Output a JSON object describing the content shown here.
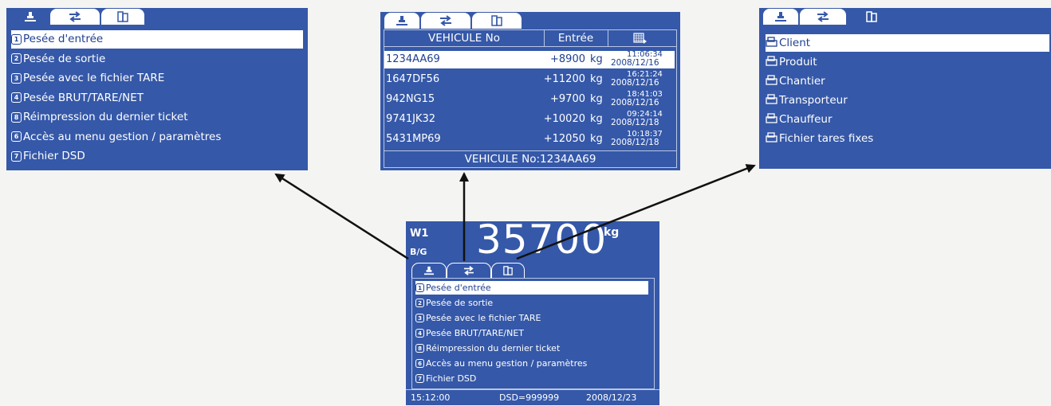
{
  "tabs": {
    "weigh_icon": "scale-icon",
    "transfer_icon": "transfer-arrows-icon",
    "files_icon": "files-icon"
  },
  "weigh_menu": {
    "items": [
      {
        "key": "F1",
        "label": "Pesée d'entrée"
      },
      {
        "key": "F2",
        "label": "Pesée de sortie"
      },
      {
        "key": "F3",
        "label": "Pesée avec le fichier TARE"
      },
      {
        "key": "F4",
        "label": "Pesée BRUT/TARE/NET"
      },
      {
        "key": "F8",
        "label": "Réimpression du dernier ticket"
      },
      {
        "key": "F6",
        "label": "Accès au menu gestion / paramètres"
      },
      {
        "key": "F7",
        "label": "Fichier DSD"
      }
    ]
  },
  "vehicle_table": {
    "headers": {
      "vehicle": "VEHICULE No",
      "entry": "Entrée",
      "datetime": "calendar-icon"
    },
    "rows": [
      {
        "plate": "1234AA69",
        "weight": "+8900",
        "unit": "kg",
        "time": "11:06:34",
        "date": "2008/12/16"
      },
      {
        "plate": "1647DF56",
        "weight": "+11200",
        "unit": "kg",
        "time": "16:21:24",
        "date": "2008/12/16"
      },
      {
        "plate": "942NG15",
        "weight": "+9700",
        "unit": "kg",
        "time": "18:41:03",
        "date": "2008/12/16"
      },
      {
        "plate": "9741JK32",
        "weight": "+10020",
        "unit": "kg",
        "time": "09:24:14",
        "date": "2008/12/18"
      },
      {
        "plate": "5431MP69",
        "weight": "+12050",
        "unit": "kg",
        "time": "10:18:37",
        "date": "2008/12/18"
      }
    ],
    "footer": "VEHICULE No:1234AA69"
  },
  "files_menu": {
    "items": [
      "Client",
      "Produit",
      "Chantier",
      "Transporteur",
      "Chauffeur",
      "Fichier tares fixes"
    ]
  },
  "main_display": {
    "channel": "W1",
    "mode": "B/G",
    "weight": "35700",
    "unit": "kg",
    "status": {
      "time": "15:12:00",
      "dsd": "DSD=999999",
      "date": "2008/12/23"
    }
  },
  "colors": {
    "screen_bg": "#3558a8",
    "arrow": "#111111",
    "page_bg": "#f4f4f2"
  }
}
